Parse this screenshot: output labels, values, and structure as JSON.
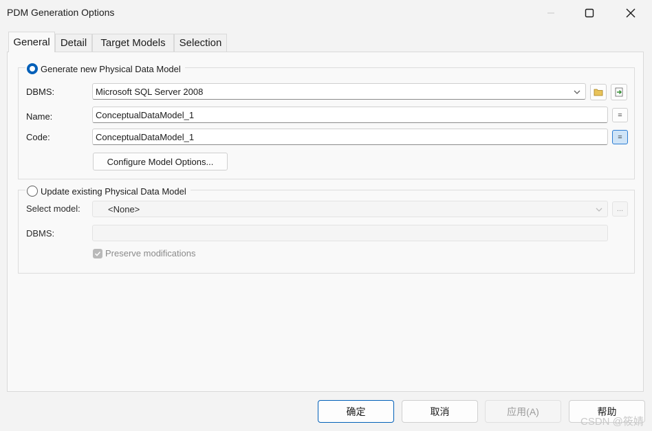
{
  "window": {
    "title": "PDM Generation Options"
  },
  "icons": {
    "minimize": "minimize-icon",
    "maximize": "maximize-icon",
    "close": "close-icon",
    "dropdown": "chevron-down-icon",
    "folder": "folder-icon",
    "properties": "properties-icon",
    "check": "check-icon"
  },
  "tabs": [
    {
      "label": "General",
      "active": true
    },
    {
      "label": "Detail",
      "active": false
    },
    {
      "label": "Target Models",
      "active": false
    },
    {
      "label": "Selection",
      "active": false
    }
  ],
  "generate_new": {
    "radio_label": "Generate new Physical Data Model",
    "selected": true,
    "dbms_label": "DBMS:",
    "dbms_value": "Microsoft SQL Server 2008",
    "name_label": "Name:",
    "name_value": "ConceptualDataModel_1",
    "code_label": "Code:",
    "code_value": "ConceptualDataModel_1",
    "equals_label": "=",
    "configure_button": "Configure Model Options..."
  },
  "update_existing": {
    "radio_label": "Update existing Physical Data Model",
    "selected": false,
    "select_model_label": "Select model:",
    "select_model_value": "<None>",
    "ellipsis_label": "...",
    "dbms_label": "DBMS:",
    "dbms_value": "",
    "preserve_label": "Preserve modifications",
    "preserve_checked": true
  },
  "footer": {
    "ok": "确定",
    "cancel": "取消",
    "apply": "应用(A)",
    "help": "帮助"
  },
  "watermark": "CSDN @筱婧",
  "colors": {
    "accent": "#005fb8",
    "highlight_button": "#cfe4f7"
  }
}
